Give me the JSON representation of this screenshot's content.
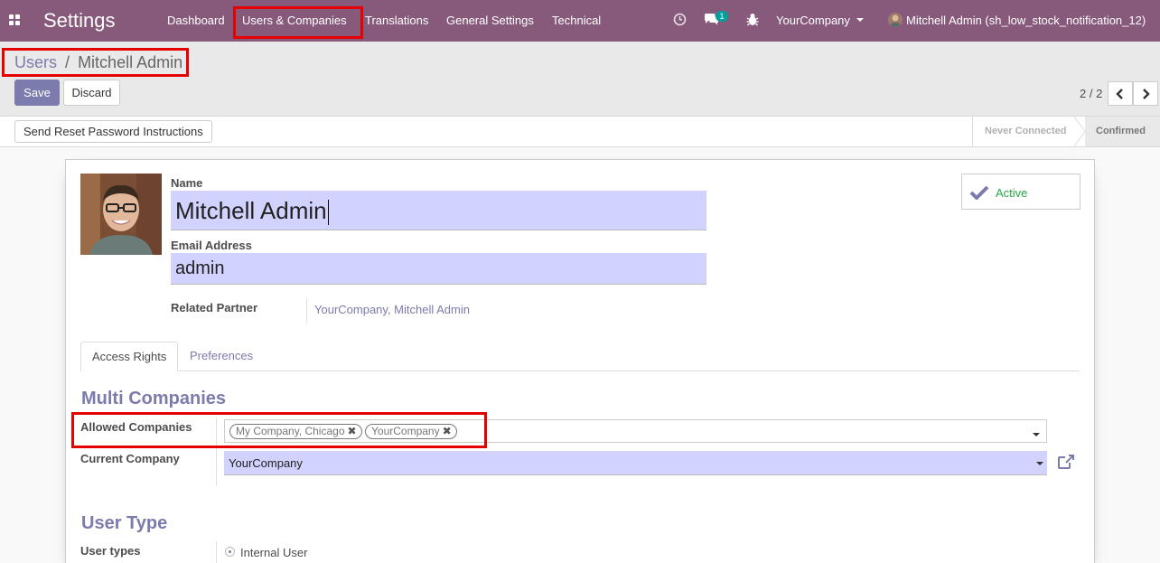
{
  "navbar": {
    "app_title": "Settings",
    "menu": [
      "Dashboard",
      "Users & Companies",
      "Translations",
      "General Settings",
      "Technical"
    ],
    "message_count": "1",
    "company": "YourCompany",
    "user": "Mitchell Admin (sh_low_stock_notification_12)",
    "color": "#875a7b"
  },
  "breadcrumb": {
    "parent": "Users",
    "separator": "/",
    "current": "Mitchell Admin"
  },
  "buttons": {
    "save": "Save",
    "discard": "Discard",
    "reset_password": "Send Reset Password Instructions"
  },
  "pager": {
    "value": "2 / 2"
  },
  "statusbar": {
    "stages": [
      "Never Connected",
      "Confirmed"
    ],
    "current": "Confirmed"
  },
  "form": {
    "name_label": "Name",
    "name_value": "Mitchell Admin",
    "email_label": "Email Address",
    "email_value": "admin",
    "partner_label": "Related Partner",
    "partner_value": "YourCompany, Mitchell Admin",
    "active_label": "Active",
    "tabs": [
      "Access Rights",
      "Preferences"
    ],
    "active_tab": "Access Rights",
    "multi_companies_title": "Multi Companies",
    "allowed_companies_label": "Allowed Companies",
    "allowed_companies": [
      "My Company, Chicago",
      "YourCompany"
    ],
    "current_company_label": "Current Company",
    "current_company_value": "YourCompany",
    "user_type_title": "User Type",
    "user_types_label": "User types",
    "user_types_value": "Internal User"
  },
  "colors": {
    "accent": "#7c7bad",
    "highlight": "#e60000",
    "required_field": "#d2d2ff"
  }
}
